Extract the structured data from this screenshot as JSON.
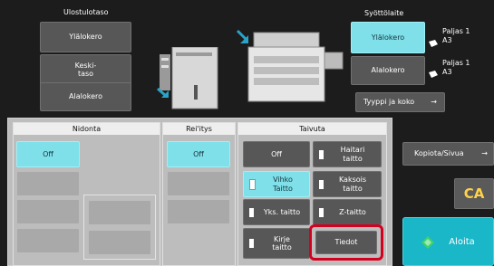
{
  "output": {
    "title": "Ulostulotaso",
    "buttons": [
      "Ylälokero",
      "Keski-\ntaso",
      "Alalokero"
    ]
  },
  "feed": {
    "title": "Syöttölaite",
    "trays": [
      {
        "label": "Ylälokero",
        "info_line1": "Paljas 1",
        "info_line2": "A3"
      },
      {
        "label": "Alalokero",
        "info_line1": "Paljas 1",
        "info_line2": "A3"
      }
    ],
    "type_size_label": "Tyyppi ja koko",
    "arrow": "→"
  },
  "stapling": {
    "title": "Nidonta",
    "off_label": "Off"
  },
  "punch": {
    "title": "Rei'itys",
    "off_label": "Off"
  },
  "fold": {
    "title": "Taivuta",
    "buttons": {
      "off": "Off",
      "haitari": "Haitari\ntaitto",
      "vihko": "Vihko\nTaitto",
      "kaksois": "Kaksois\ntaitto",
      "yks": "Yks. taitto",
      "z": "Z-taitto",
      "kirje": "Kirje\ntaitto",
      "tiedot": "Tiedot"
    }
  },
  "right": {
    "copies_label": "Kopiota/Sivua",
    "arrow": "→",
    "ca_label": "CA",
    "start_label": "Aloita"
  },
  "colors": {
    "accent_cyan": "#7fe0ea",
    "start_cyan": "#1ab7c8",
    "highlight_red": "#d4001f",
    "ca_yellow": "#ffd24a"
  }
}
